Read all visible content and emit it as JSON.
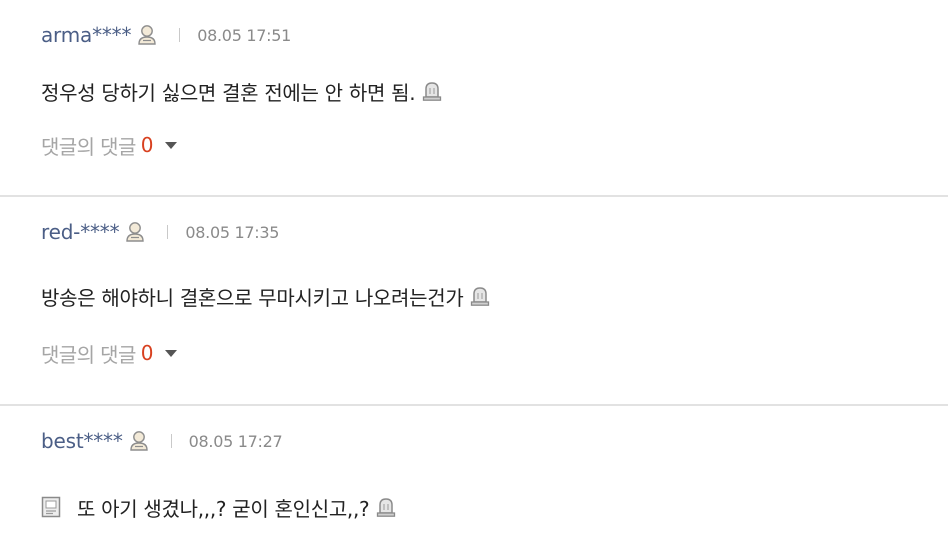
{
  "comments": [
    {
      "nickname": "arma****",
      "date": "08.05 17:51",
      "text": "정우성 당하기 싫으면 결혼 전에는 안 하면 됨.",
      "has_doc_icon": false,
      "reply_label": "댓글의 댓글",
      "reply_count": "0"
    },
    {
      "nickname": "red-****",
      "date": "08.05 17:35",
      "text": "방송은 해야하니 결혼으로 무마시키고 나오려는건가",
      "has_doc_icon": false,
      "reply_label": "댓글의 댓글",
      "reply_count": "0"
    },
    {
      "nickname": "best****",
      "date": "08.05 17:27",
      "text": "또 아기 생겼나,,,? 굳이 혼인신고,,?",
      "has_doc_icon": true
    }
  ],
  "icons": {
    "user": "user-icon",
    "report": "report-icon",
    "document": "document-icon",
    "caret": "chevron-down-icon"
  },
  "colors": {
    "nickname": "#4b5e86",
    "reply_count": "#d8401f",
    "divider": "#e2e2e2"
  }
}
